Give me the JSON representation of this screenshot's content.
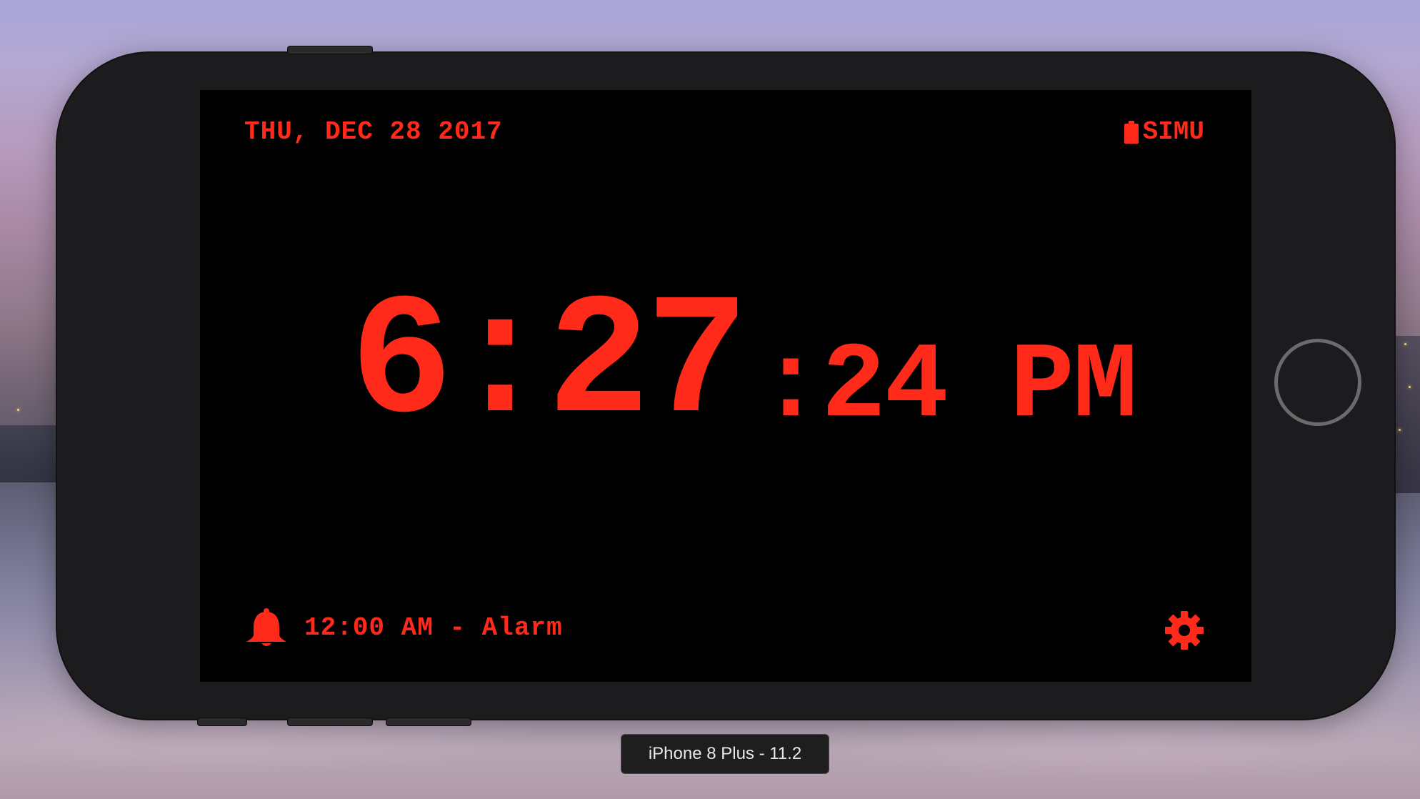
{
  "clock_app": {
    "date": "THU, DEC 28 2017",
    "battery_label": "SIMU",
    "time_hours_minutes": "6:27",
    "time_seconds_ampm": ":24 PM",
    "alarm_text": "12:00 AM - Alarm",
    "accent_color": "#ff2a1a",
    "icons": {
      "battery": "battery-icon",
      "alarm": "bell-icon",
      "settings": "gear-icon"
    }
  },
  "simulator": {
    "device_caption": "iPhone 8 Plus - 11.2"
  }
}
